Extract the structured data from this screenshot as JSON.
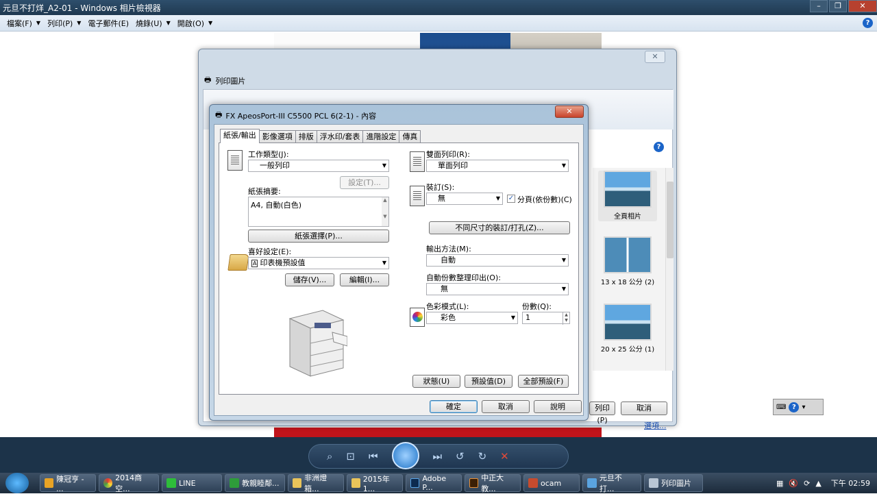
{
  "viewer": {
    "title": "元旦不打烊_A2-01 - Windows 相片檢視器",
    "menu": [
      "檔案(F)",
      "列印(P)",
      "電子郵件(E)",
      "燒錄(U)",
      "開啟(O)"
    ]
  },
  "print_dialog": {
    "title": "列印圖片",
    "thumbnails": [
      "全頁相片",
      "13 x 18 公分 (2)",
      "20 x 25 公分 (1)"
    ],
    "options_link": "選項...",
    "print_button": "列印(P)",
    "cancel_button": "取消"
  },
  "properties": {
    "title": "FX ApeosPort-III C5500 PCL 6(2-1) - 內容",
    "tabs": [
      "紙張/輸出",
      "影像選項",
      "排版",
      "浮水印/套表",
      "進階設定",
      "傳真"
    ],
    "job_type_label": "工作類型(J):",
    "job_type_value": "一般列印",
    "setup_button": "設定(T)...",
    "paper_summary_label": "紙張摘要:",
    "paper_summary_value": "A4, 自動(白色)",
    "paper_select_button": "紙張選擇(P)...",
    "favorites_label": "喜好設定(E):",
    "favorites_value": "印表機預設值",
    "save_button": "儲存(V)...",
    "edit_button": "編輯(I)...",
    "duplex_label": "雙面列印(R):",
    "duplex_value": "單面列印",
    "staple_label": "裝訂(S):",
    "staple_value": "無",
    "collate_label": "分頁(依份數)(C)",
    "mixed_size_button": "不同尺寸的裝訂/打孔(Z)...",
    "output_label": "輸出方法(M):",
    "output_value": "自動",
    "auto_collate_label": "自動份數整理印出(O):",
    "auto_collate_value": "無",
    "color_mode_label": "色彩模式(L):",
    "color_mode_value": "彩色",
    "copies_label": "份數(Q):",
    "copies_value": "1",
    "status_button": "狀態(U)",
    "defaults_button": "預設值(D)",
    "all_defaults_button": "全部預設(F)",
    "ok_button": "確定",
    "cancel_button": "取消",
    "help_button": "說明"
  },
  "taskbar": {
    "items": [
      "陳冠亨 - ...",
      "2014商空...",
      "LINE",
      "教親睦鄰...",
      "非洲燈箱...",
      "2015年1...",
      "Adobe P...",
      "中正大教...",
      "ocam",
      "元旦不打...",
      "列印圖片"
    ],
    "clock": "下午 02:59"
  }
}
